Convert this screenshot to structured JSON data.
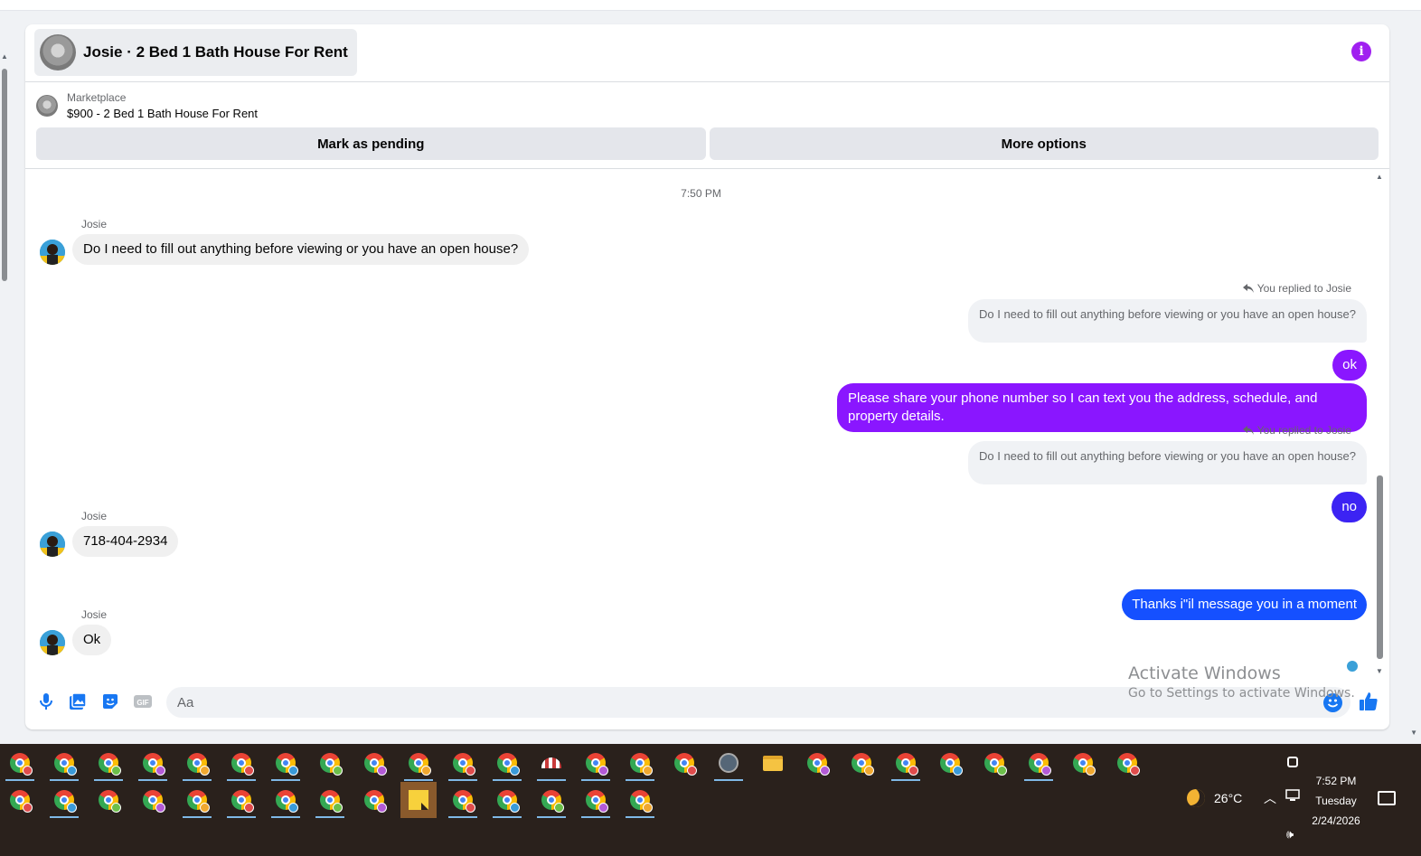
{
  "conversation": {
    "title": "Josie · 2 Bed 1 Bath House For Rent",
    "listing_source": "Marketplace",
    "listing_price": "$900 - 2 Bed 1 Bath House For Rent",
    "mark_pending_label": "Mark as pending",
    "more_options_label": "More options"
  },
  "messages": {
    "timestamp": "7:50 PM",
    "sender_name": "Josie",
    "reply_label": "You replied to Josie",
    "quoted_text": "Do I need to fill out anything before viewing or you have an open house?",
    "items": [
      {
        "direction": "in",
        "text": "Do I need to fill out anything before viewing or you have an open house?"
      },
      {
        "direction": "out",
        "text": "ok"
      },
      {
        "direction": "out",
        "text": "Please share your phone number so I can text you the address, schedule, and property details."
      },
      {
        "direction": "out",
        "text": "no"
      },
      {
        "direction": "in",
        "text": "718-404-2934"
      },
      {
        "direction": "out",
        "text": "Thanks i\"il message you in a moment"
      },
      {
        "direction": "in",
        "text": "Ok"
      }
    ]
  },
  "composer": {
    "placeholder": "Aa",
    "icons": [
      "microphone-icon",
      "photo-icon",
      "sticker-icon",
      "gif-icon",
      "emoji-icon",
      "like-icon"
    ]
  },
  "watermark": {
    "title": "Activate Windows",
    "subtitle": "Go to Settings to activate Windows."
  },
  "taskbar": {
    "temperature": "26°C",
    "time": "7:52 PM",
    "day": "Tuesday",
    "date": "2/24/2026"
  },
  "colors": {
    "accent_purple": "#8a16ff",
    "accent_blue": "#1550ff",
    "info_icon": "#a020f0",
    "messenger_blue": "#1877f2"
  }
}
